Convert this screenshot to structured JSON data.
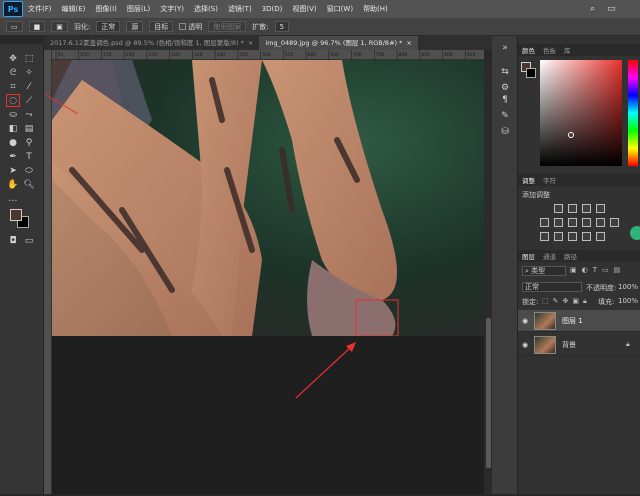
{
  "app": {
    "logo": "Ps"
  },
  "menu": [
    "文件(F)",
    "编辑(E)",
    "图像(I)",
    "图层(L)",
    "文字(Y)",
    "选择(S)",
    "滤镜(T)",
    "3D(D)",
    "视图(V)",
    "窗口(W)",
    "帮助(H)"
  ],
  "options": {
    "feather_label": "羽化:",
    "mode_value": "正常",
    "btn_erase": "源",
    "btn_target": "目标",
    "transparent_label": "透明",
    "use_pattern_label": "使用图案",
    "diffusion_label": "扩散:",
    "diffusion_value": "5"
  },
  "tabs": [
    {
      "label": "2017.6.12素盖调色.psd @ 89.5% (色相/饱和度 1, 图层蒙版/8) *",
      "active": false
    },
    {
      "label": "img_0489.jpg @ 96.7% (图层 1, RGB/8#) *",
      "active": true
    }
  ],
  "ruler": {
    "labels": [
      "50",
      "100",
      "150",
      "200",
      "250",
      "300",
      "350",
      "400",
      "450",
      "500",
      "550",
      "600",
      "650",
      "700",
      "750",
      "800",
      "850",
      "900",
      "950"
    ]
  },
  "panels": {
    "color_tabs": [
      "颜色",
      "色板",
      "库"
    ],
    "adjust_tabs": [
      "调整",
      "字符"
    ],
    "add_adjustment_label": "添加调整",
    "layer_tabs": [
      "图层",
      "通道",
      "路径"
    ],
    "kind_label": "类型",
    "blend_mode": "正常",
    "opacity_label": "不透明度:",
    "opacity_value": "100%",
    "lock_label": "锁定:",
    "fill_label": "填充:",
    "fill_value": "100%",
    "layers": [
      {
        "name": "图层 1",
        "selected": true
      },
      {
        "name": "背景",
        "selected": false
      }
    ]
  },
  "colors": {
    "accent": "#31a8ff",
    "annotation": "#e8322c",
    "foreground": "#4a3530",
    "background": "#000000"
  }
}
